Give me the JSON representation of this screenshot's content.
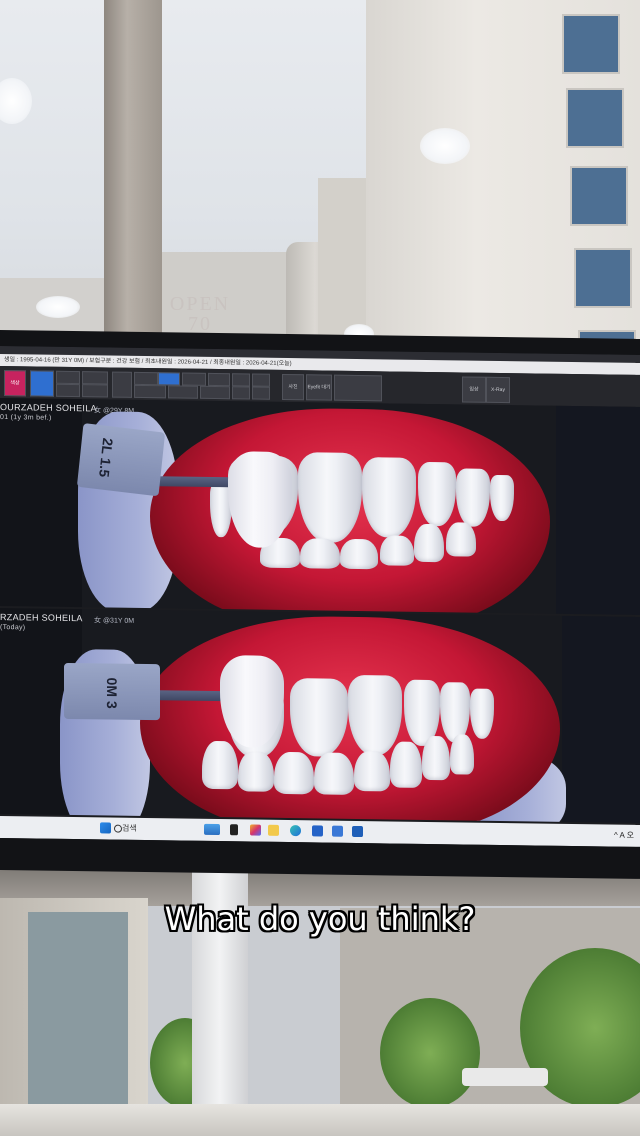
{
  "caption": "What do you think?",
  "screen": {
    "title_bar": "생일 : 1995-04-16 (만 31Y 0M) / 보험구분 : 건강 보험 / 최초내원일 : 2026-04-21 / 최종내원일 : 2026-04-21(오늘)",
    "toolbar": {
      "home_label": "색상",
      "search_label": "검색",
      "buttons": [
        "임상",
        "사진",
        "Eyefit 대기",
        "X-Ray"
      ]
    },
    "top_image": {
      "patient_name": "OURZADEH SOHEILA",
      "patient_sub": "01 (1y 3m bef.)",
      "age_label": "女 @29Y 8M",
      "shade_tab": "2L 1.5"
    },
    "bottom_image": {
      "patient_name": "RZADEH SOHEILA",
      "patient_sub": "(Today)",
      "age_label": "女 @31Y 0M",
      "shade_tab": "0M 3"
    },
    "taskbar": {
      "search_text": "검색",
      "tray_text": "^ A 오"
    }
  },
  "background": {
    "sign_text": "OPEN 70"
  },
  "colors": {
    "caption_fill": "#ffffff",
    "caption_stroke": "#000000",
    "accent": "#c7235f",
    "taskbar": "#eceef2"
  },
  "icons": [
    "windows-start-icon",
    "search-icon",
    "file-explorer-icon",
    "edge-browser-icon",
    "app-icon",
    "chevron-up-icon"
  ]
}
